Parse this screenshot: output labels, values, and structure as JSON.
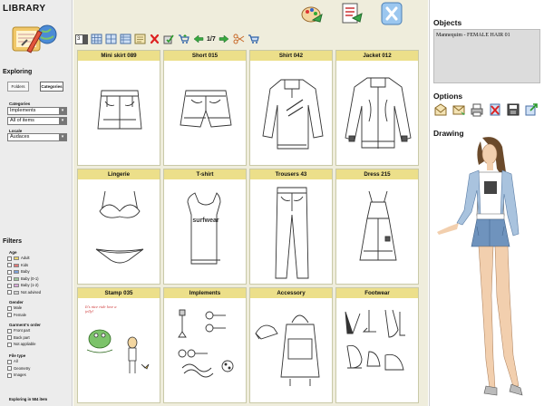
{
  "left": {
    "title": "LIBRARY",
    "exploring": "Exploring",
    "tabs": [
      "Folders",
      "Categories"
    ],
    "categories_label": "Categories",
    "category_1": "Implements",
    "category_2": "All of items",
    "locale_label": "Locale",
    "locale": "Audaces",
    "filters": "Filters",
    "age_label": "Age",
    "age_items": [
      {
        "label": "Adult",
        "color": "#e8d36a"
      },
      {
        "label": "Kids",
        "color": "#e07777"
      },
      {
        "label": "Baby",
        "color": "#7aa0d8"
      },
      {
        "label": "Baby (0-1)",
        "color": "#9bc59b"
      },
      {
        "label": "Baby (1-2)",
        "color": "#d9a6d9"
      },
      {
        "label": "Not advised",
        "color": "#d0d0d0"
      }
    ],
    "gender_label": "Gender",
    "gender_items": [
      "Male",
      "Female"
    ],
    "order_label": "Garment's order",
    "order_items": [
      "Front part",
      "Back part",
      "Not appliable"
    ],
    "filetype_label": "File type",
    "filetype_items": [
      "All",
      "Geometry",
      "Images"
    ],
    "status": "Exploring in 584 item"
  },
  "toolbar": {
    "page_select": "3",
    "page_indicator": "1/7"
  },
  "items": [
    {
      "title": "Mini skirt 089",
      "kind": "skirt"
    },
    {
      "title": "Short  015",
      "kind": "short"
    },
    {
      "title": "Shirt 042",
      "kind": "shirt"
    },
    {
      "title": "Jacket 012",
      "kind": "jacket"
    },
    {
      "title": "Lingerie",
      "kind": "lingerie"
    },
    {
      "title": "T-shirt",
      "kind": "tshirt"
    },
    {
      "title": "Trousers 43",
      "kind": "trousers"
    },
    {
      "title": "Dress 215",
      "kind": "dress"
    },
    {
      "title": "Stamp 035",
      "kind": "stamp"
    },
    {
      "title": "Implements",
      "kind": "implements"
    },
    {
      "title": "Accessory",
      "kind": "accessory"
    },
    {
      "title": "Footwear",
      "kind": "footwear"
    }
  ],
  "stamp_text": "It's nice ride love a jelly!",
  "tshirt_print": "surfwear",
  "right": {
    "objects_title": "Objects",
    "object_value": "Mannequim  - FEMALE HAIR 01",
    "options_title": "Options",
    "drawing_title": "Drawing"
  },
  "colors": {
    "card_header": "#ecdf8a",
    "center_bg": "#efeddc",
    "panel_bg": "#ececec",
    "jeans": "#6f93bd"
  }
}
